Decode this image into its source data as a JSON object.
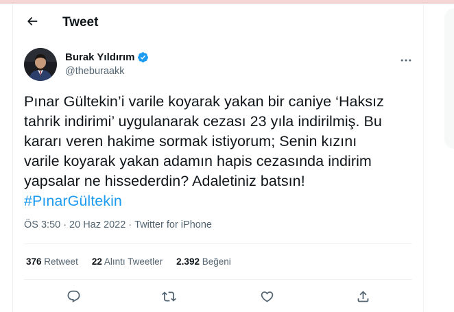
{
  "header": {
    "title": "Tweet"
  },
  "author": {
    "name": "Burak Yıldırım",
    "handle": "@theburaakk",
    "verified": true
  },
  "tweet": {
    "lines": [
      "Pınar Gültekin’i varile koyarak yakan bir caniye ‘Haksız",
      "tahrik indirimi’ uygulanarak cezası 23 yıla indirilmiş. Bu",
      "kararı veren hakime sormak istiyorum; Senin kızını",
      "varile koyarak yakan adamın hapis cezasında indirim",
      "yapsalar ne hissederdin? Adaletiniz batsın!"
    ],
    "hashtag": "#PınarGültekin"
  },
  "meta": {
    "time": "ÖS 3:50",
    "separator": "·",
    "date": "20 Haz 2022",
    "source": "Twitter for iPhone"
  },
  "stats": [
    {
      "count": "376",
      "label": "Retweet"
    },
    {
      "count": "22",
      "label": "Alıntı Tweetler"
    },
    {
      "count": "2.392",
      "label": "Beğeni"
    }
  ],
  "colors": {
    "accent": "#1d9bf0",
    "secondary_text": "#536471",
    "primary_text": "#0f1419",
    "divider": "#eff3f4"
  },
  "icons": {
    "back": "arrow-left-icon",
    "verified": "verified-badge-icon",
    "more": "more-horizontal-icon",
    "reply": "reply-icon",
    "retweet": "retweet-icon",
    "like": "heart-icon",
    "share": "share-icon"
  }
}
